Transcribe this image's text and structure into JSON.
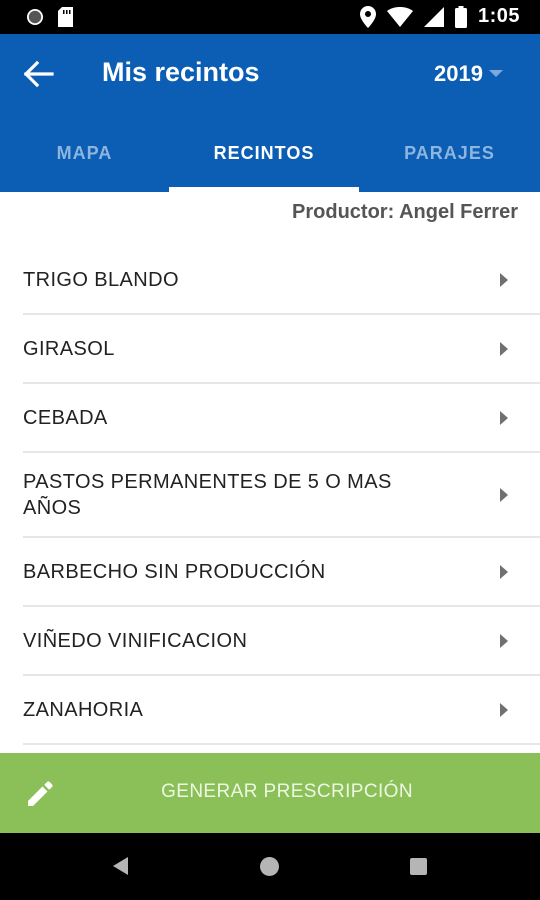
{
  "status_bar": {
    "time": "1:05"
  },
  "app_bar": {
    "title": "Mis recintos",
    "year": "2019"
  },
  "tabs": [
    {
      "label": "MAPA",
      "active": false
    },
    {
      "label": "RECINTOS",
      "active": true
    },
    {
      "label": "PARAJES",
      "active": false
    }
  ],
  "producer": "Productor: Angel Ferrer",
  "crops": [
    {
      "label": "TRIGO BLANDO"
    },
    {
      "label": "GIRASOL"
    },
    {
      "label": "CEBADA"
    },
    {
      "label": "PASTOS PERMANENTES DE 5 O MAS AÑOS"
    },
    {
      "label": "BARBECHO SIN PRODUCCIÓN"
    },
    {
      "label": "VIÑEDO VINIFICACION"
    },
    {
      "label": "ZANAHORIA"
    }
  ],
  "action_button": {
    "label": "GENERAR PRESCRIPCIÓN"
  },
  "colors": {
    "app_bar": "#0b5eb3",
    "tab_inactive": "#8eb5e0",
    "action_button": "#8bc058",
    "divider": "#e6e6e6"
  },
  "icons": {
    "back": "arrow-left",
    "dropdown": "caret-down",
    "row": "chevron-right",
    "action": "pencil"
  }
}
